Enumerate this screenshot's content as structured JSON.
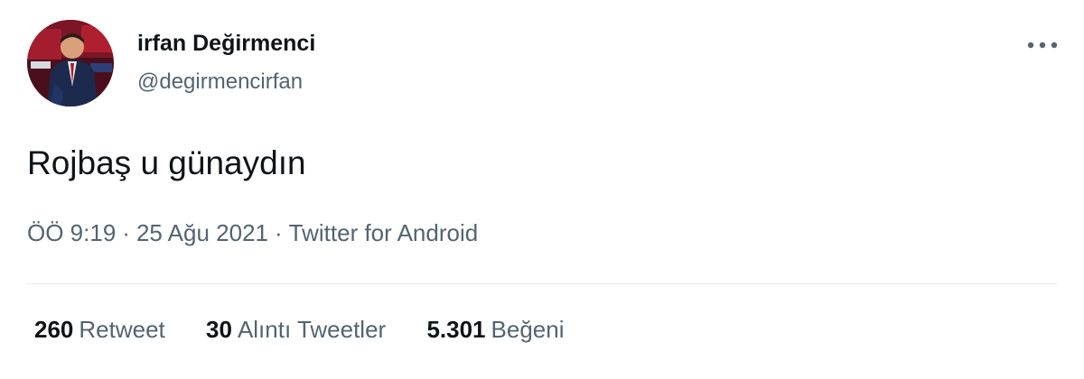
{
  "user": {
    "display_name": "irfan Değirmenci",
    "handle": "@degirmencirfan"
  },
  "tweet": {
    "text": "Rojbaş u günaydın",
    "time": "ÖÖ 9:19",
    "separator": "·",
    "date": "25 Ağu 2021",
    "source": "Twitter for Android"
  },
  "stats": [
    {
      "count": "260",
      "label": "Retweet"
    },
    {
      "count": "30",
      "label": "Alıntı Tweetler"
    },
    {
      "count": "5.301",
      "label": "Beğeni"
    }
  ],
  "icons": {
    "more": "more-horizontal-icon"
  },
  "colors": {
    "primary_text": "#0f1419",
    "secondary_text": "#536471",
    "divider": "#e7e9ea",
    "background": "#ffffff"
  }
}
